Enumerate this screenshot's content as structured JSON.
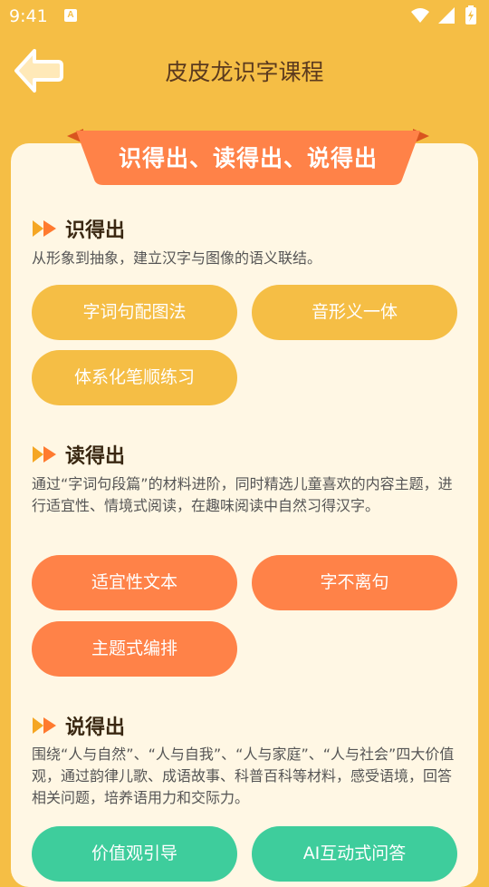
{
  "status_bar": {
    "time": "9:41",
    "notif_letter": "A"
  },
  "header": {
    "title": "皮皮龙识字课程"
  },
  "banner": {
    "title": "识得出、读得出、说得出"
  },
  "sections": [
    {
      "title": "识得出",
      "desc": "从形象到抽象，建立汉字与图像的语义联结。",
      "pill_color": "#F5BE45",
      "buttons": [
        "字词句配图法",
        "音形义一体",
        "体系化笔顺练习"
      ]
    },
    {
      "title": "读得出",
      "desc": "通过“字词句段篇”的材料进阶，同时精选儿童喜欢的内容主题，进行适宜性、情境式阅读，在趣味阅读中自然习得汉字。",
      "pill_color": "#FF8248",
      "buttons": [
        "适宜性文本",
        "字不离句",
        "主题式编排"
      ]
    },
    {
      "title": "说得出",
      "desc": "围绕“人与自然”、“人与自我”、“人与家庭”、“人与社会”四大价值观，通过韵律儿歌、成语故事、科普百科等材料，感受语境，回答相关问题，培养语用力和交际力。",
      "pill_color": "#3ECD9C",
      "buttons": [
        "价值观引导",
        "AI互动式问答"
      ]
    }
  ],
  "icons": {
    "back": "arrow-left-icon",
    "section": "double-chevron-right-icon",
    "status": [
      "wifi-icon",
      "cell-signal-icon",
      "battery-charging-icon"
    ]
  }
}
